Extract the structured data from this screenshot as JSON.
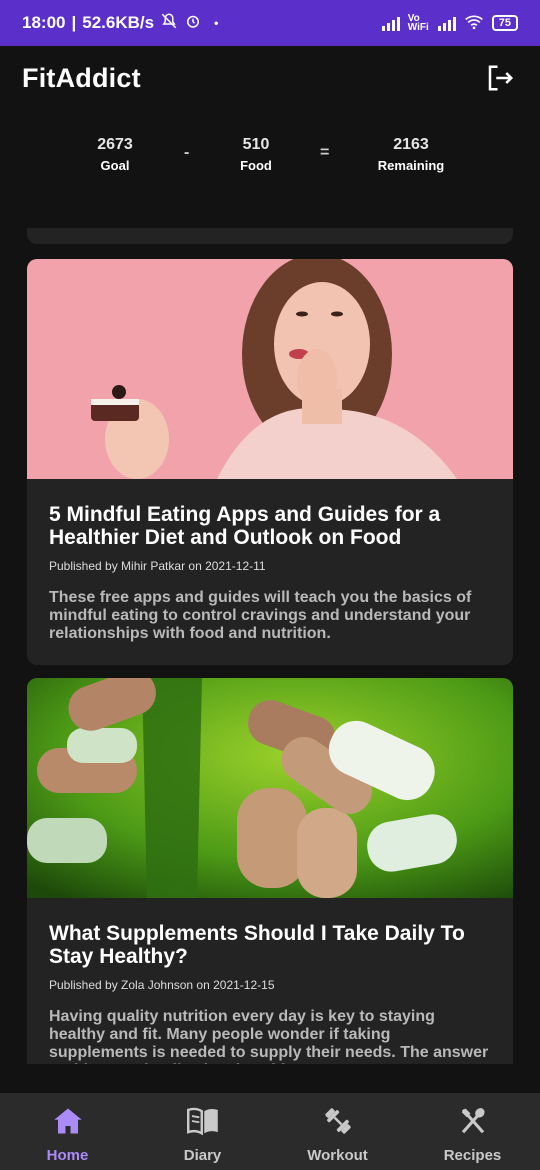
{
  "status_bar": {
    "time": "18:00",
    "speed": "52.6KB/s",
    "network": "Vo WiFi",
    "battery": "75"
  },
  "header": {
    "title": "FitAddict"
  },
  "summary": {
    "goal_value": "2673",
    "goal_label": "Goal",
    "minus": "-",
    "food_value": "510",
    "food_label": "Food",
    "equals": "=",
    "remaining_value": "2163",
    "remaining_label": "Remaining"
  },
  "articles": [
    {
      "title": "5 Mindful Eating Apps and Guides for a Healthier Diet and Outlook on Food",
      "meta": "Published by Mihir Patkar on 2021-12-11",
      "description": "These free apps and guides will teach you the basics of mindful eating to control cravings and understand your relationships with food and nutrition."
    },
    {
      "title": "What Supplements Should I Take Daily To Stay Healthy?",
      "meta": "Published by Zola Johnson on 2021-12-15",
      "description": "Having quality nutrition every day is key to staying healthy and fit. Many people wonder if taking supplements is needed to supply their needs. The answer to this question lies in a lot of factors. Here's"
    }
  ],
  "nav": {
    "items": [
      {
        "label": "Home",
        "icon": "home-icon"
      },
      {
        "label": "Diary",
        "icon": "book-icon"
      },
      {
        "label": "Workout",
        "icon": "dumbbell-icon"
      },
      {
        "label": "Recipes",
        "icon": "utensils-icon"
      }
    ],
    "active": "Home",
    "active_color": "#a98cf5"
  },
  "colors": {
    "status_bar": "#5b2fc9",
    "background": "#121212",
    "card": "#232323",
    "nav_bar": "#2b2b2b"
  }
}
